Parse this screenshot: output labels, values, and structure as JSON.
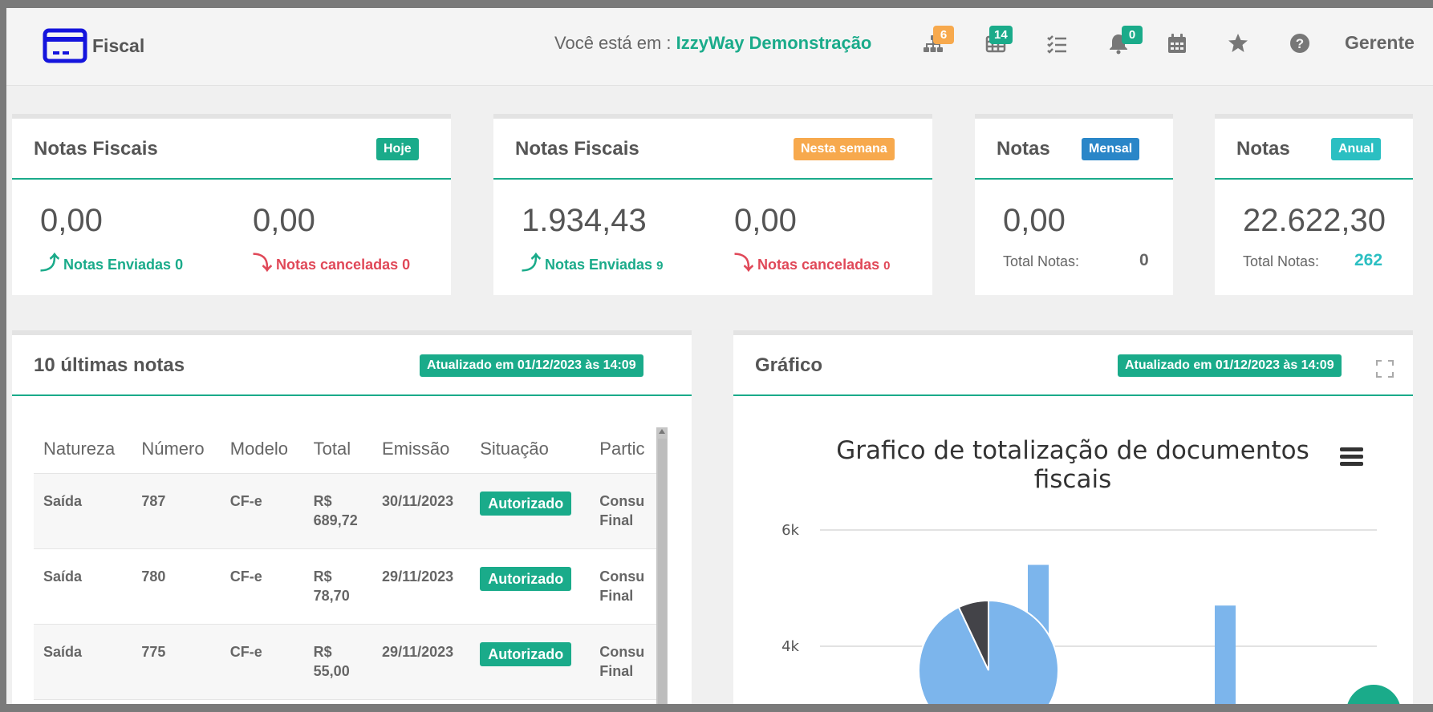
{
  "header": {
    "brand": "Fiscal",
    "location_prefix": "Você está em :",
    "location_name": "IzzyWay Demonstração",
    "user": "Gerente",
    "badges": {
      "org": "6",
      "table": "14",
      "bell": "0"
    }
  },
  "cards": {
    "today": {
      "title": "Notas Fiscais",
      "tag": "Hoje",
      "sent_value": "0,00",
      "sent_label": "Notas Enviadas",
      "sent_count": "0",
      "cancel_value": "0,00",
      "cancel_label": "Notas canceladas",
      "cancel_count": "0"
    },
    "week": {
      "title": "Notas Fiscais",
      "tag": "Nesta semana",
      "sent_value": "1.934,43",
      "sent_label": "Notas Enviadas",
      "sent_count": "9",
      "cancel_value": "0,00",
      "cancel_label": "Notas canceladas",
      "cancel_count": "0"
    },
    "month": {
      "title": "Notas",
      "tag": "Mensal",
      "value": "0,00",
      "total_label": "Total Notas:",
      "total_count": "0"
    },
    "year": {
      "title": "Notas",
      "tag": "Anual",
      "value": "22.622,30",
      "total_label": "Total Notas:",
      "total_count": "262"
    }
  },
  "last_notes": {
    "title": "10 últimas notas",
    "updated": "Atualizado em 01/12/2023 às 14:09",
    "columns": [
      "Natureza",
      "Número",
      "Modelo",
      "Total",
      "Emissão",
      "Situação",
      "Partic"
    ],
    "rows": [
      {
        "natureza": "Saída",
        "numero": "787",
        "modelo": "CF-e",
        "total_a": "R$",
        "total_b": "689,72",
        "emissao": "30/11/2023",
        "situacao": "Autorizado",
        "part_a": "Consu",
        "part_b": "Final"
      },
      {
        "natureza": "Saída",
        "numero": "780",
        "modelo": "CF-e",
        "total_a": "R$",
        "total_b": "78,70",
        "emissao": "29/11/2023",
        "situacao": "Autorizado",
        "part_a": "Consu",
        "part_b": "Final"
      },
      {
        "natureza": "Saída",
        "numero": "775",
        "modelo": "CF-e",
        "total_a": "R$",
        "total_b": "55,00",
        "emissao": "29/11/2023",
        "situacao": "Autorizado",
        "part_a": "Consu",
        "part_b": "Final"
      }
    ]
  },
  "chart_panel": {
    "title": "Gráfico",
    "updated": "Atualizado em 01/12/2023 às 14:09"
  },
  "chart_data": {
    "type": "bar",
    "title": "Grafico de totalização de documentos fiscais",
    "y_ticks": [
      "6k",
      "4k"
    ],
    "ylim": [
      2800,
      6000
    ],
    "bars": [
      5400,
      4700
    ],
    "pie": [
      {
        "value": 93,
        "color": "#7cb5ec"
      },
      {
        "value": 7,
        "color": "#434348"
      }
    ]
  },
  "colors": {
    "accent": "#1aab8a",
    "hoje": "#1aab8a",
    "semana": "#f7a94d",
    "mensal": "#2a86c8",
    "anual": "#2bbfc2",
    "danger": "#e04858"
  }
}
